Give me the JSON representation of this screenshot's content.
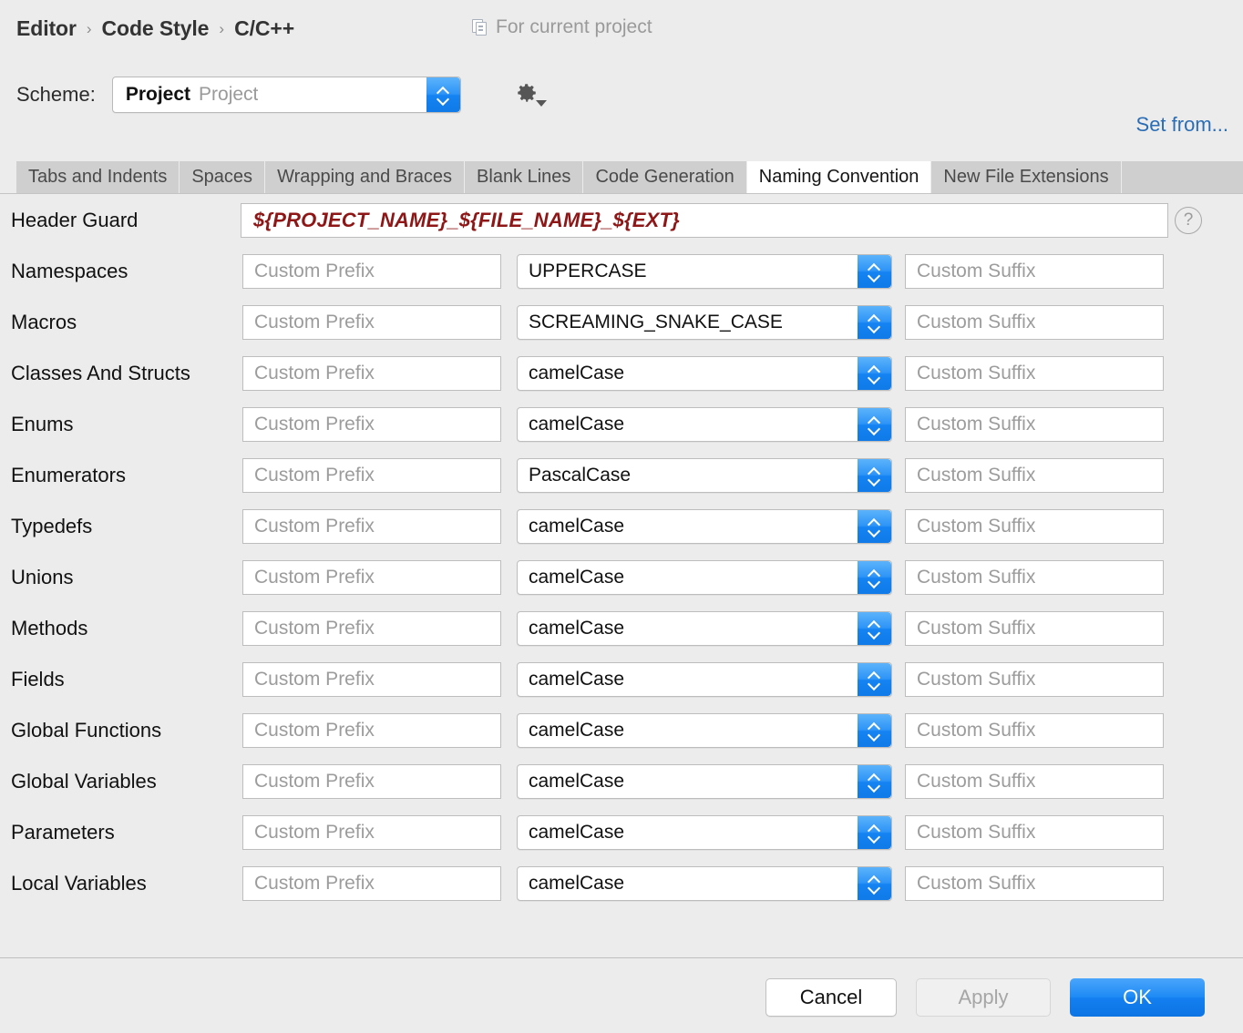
{
  "breadcrumb": {
    "items": [
      "Editor",
      "Code Style",
      "C/C++"
    ],
    "separator": "›"
  },
  "scope_note": {
    "icon": "copy-icon",
    "label": "For current project"
  },
  "scheme": {
    "label": "Scheme:",
    "value_bold": "Project",
    "value_dim": "Project",
    "gear_icon": "gear-icon"
  },
  "set_from": {
    "label": "Set from...",
    "color": "#2a6db5"
  },
  "tabs": [
    {
      "label": "Tabs and Indents",
      "active": false
    },
    {
      "label": "Spaces",
      "active": false
    },
    {
      "label": "Wrapping and Braces",
      "active": false
    },
    {
      "label": "Blank Lines",
      "active": false
    },
    {
      "label": "Code Generation",
      "active": false
    },
    {
      "label": "Naming Convention",
      "active": true
    },
    {
      "label": "New File Extensions",
      "active": false
    }
  ],
  "header_guard": {
    "label": "Header Guard",
    "value": "${PROJECT_NAME}_${FILE_NAME}_${EXT}",
    "value_color": "#8e1616",
    "help_icon": "question-mark-icon",
    "help_glyph": "?"
  },
  "placeholders": {
    "prefix": "Custom Prefix",
    "suffix": "Custom Suffix"
  },
  "rows": [
    {
      "label": "Namespaces",
      "prefix": "",
      "style": "UPPERCASE",
      "suffix": ""
    },
    {
      "label": "Macros",
      "prefix": "",
      "style": "SCREAMING_SNAKE_CASE",
      "suffix": ""
    },
    {
      "label": "Classes And Structs",
      "prefix": "",
      "style": "camelCase",
      "suffix": ""
    },
    {
      "label": "Enums",
      "prefix": "",
      "style": "camelCase",
      "suffix": ""
    },
    {
      "label": "Enumerators",
      "prefix": "",
      "style": "PascalCase",
      "suffix": ""
    },
    {
      "label": "Typedefs",
      "prefix": "",
      "style": "camelCase",
      "suffix": ""
    },
    {
      "label": "Unions",
      "prefix": "",
      "style": "camelCase",
      "suffix": ""
    },
    {
      "label": "Methods",
      "prefix": "",
      "style": "camelCase",
      "suffix": ""
    },
    {
      "label": "Fields",
      "prefix": "",
      "style": "camelCase",
      "suffix": ""
    },
    {
      "label": "Global Functions",
      "prefix": "",
      "style": "camelCase",
      "suffix": ""
    },
    {
      "label": "Global Variables",
      "prefix": "",
      "style": "camelCase",
      "suffix": ""
    },
    {
      "label": "Parameters",
      "prefix": "",
      "style": "camelCase",
      "suffix": ""
    },
    {
      "label": "Local Variables",
      "prefix": "",
      "style": "camelCase",
      "suffix": ""
    }
  ],
  "footer": {
    "cancel_label": "Cancel",
    "apply_label": "Apply",
    "apply_enabled": false,
    "ok_label": "OK",
    "ok_color": "#1583f2"
  }
}
